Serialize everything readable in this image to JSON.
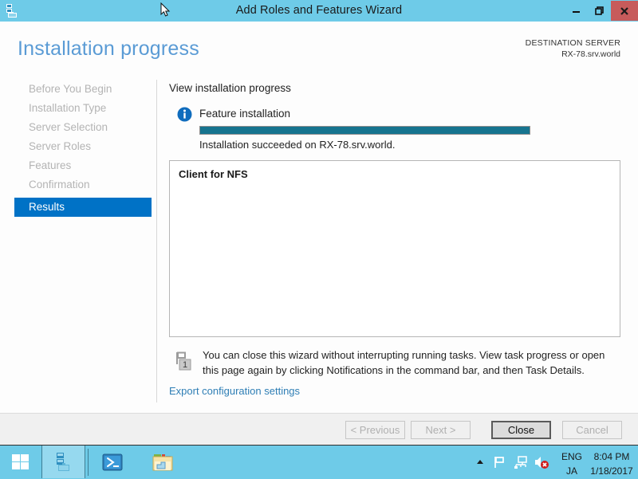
{
  "window": {
    "title": "Add Roles and Features Wizard",
    "icon": "server-manager-icon",
    "controls": {
      "minimize": "minimize-icon",
      "maximize": "restore-icon",
      "close": "X"
    }
  },
  "header": {
    "page_title": "Installation progress",
    "destination_label": "DESTINATION SERVER",
    "destination_server": "RX-78.srv.world"
  },
  "sidebar": {
    "items": [
      {
        "label": "Before You Begin",
        "active": false
      },
      {
        "label": "Installation Type",
        "active": false
      },
      {
        "label": "Server Selection",
        "active": false
      },
      {
        "label": "Server Roles",
        "active": false
      },
      {
        "label": "Features",
        "active": false
      },
      {
        "label": "Confirmation",
        "active": false
      },
      {
        "label": "Results",
        "active": true
      }
    ]
  },
  "main": {
    "section_label": "View installation progress",
    "install_type_label": "Feature installation",
    "progress": {
      "percent": 100,
      "status_text": "Installation succeeded on RX-78.srv.world."
    },
    "results": [
      "Client for NFS"
    ],
    "notice_text": "You can close this wizard without interrupting running tasks. View task progress or open this page again by clicking Notifications in the command bar, and then Task Details.",
    "notice_badge": "1",
    "export_link": "Export configuration settings"
  },
  "footer": {
    "previous_label": "< Previous",
    "next_label": "Next >",
    "close_label": "Close",
    "cancel_label": "Cancel"
  },
  "taskbar": {
    "start": "windows-logo-icon",
    "apps": [
      {
        "name": "server-manager",
        "active": true
      },
      {
        "name": "powershell",
        "active": false
      },
      {
        "name": "file-explorer",
        "active": false
      }
    ],
    "tray": {
      "language_primary": "ENG",
      "language_secondary": "JA",
      "time": "8:04 PM",
      "date": "1/18/2017"
    }
  },
  "colors": {
    "titlebar": "#6ecbe8",
    "close_button": "#c75b5b",
    "accent_blue": "#0072c6",
    "title_blue": "#5a9bd5",
    "progress_fill": "#17748f",
    "link_blue": "#2e7eb5"
  }
}
